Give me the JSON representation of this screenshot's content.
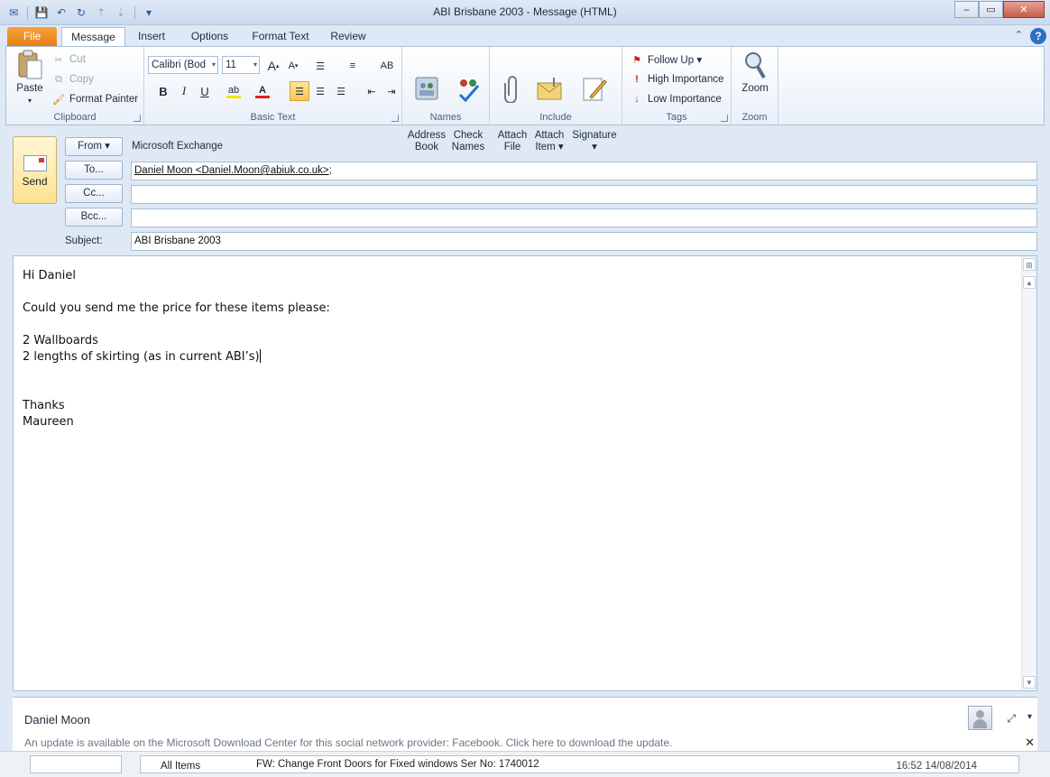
{
  "window": {
    "title": "ABI Brisbane 2003  -  Message (HTML)",
    "min_glyph": "–",
    "max_glyph": "▭",
    "close_glyph": "✕"
  },
  "qat": {
    "more_glyph": "▾"
  },
  "tabs": [
    {
      "label": "File"
    },
    {
      "label": "Message"
    },
    {
      "label": "Insert"
    },
    {
      "label": "Options"
    },
    {
      "label": "Format Text"
    },
    {
      "label": "Review"
    }
  ],
  "help_glyph": "?",
  "ribbon": {
    "clipboard": {
      "label": "Clipboard",
      "paste": "Paste",
      "cut": "Cut",
      "copy": "Copy",
      "format_painter": "Format Painter"
    },
    "basic_text": {
      "label": "Basic Text",
      "font_name": "Calibri (Bod",
      "font_size": "11",
      "grow": "A",
      "shrink": "A",
      "bold": "B",
      "italic": "I",
      "underline": "U"
    },
    "names": {
      "label": "Names",
      "address_book": "Address\nBook",
      "check_names": "Check\nNames"
    },
    "include": {
      "label": "Include",
      "attach_file": "Attach\nFile",
      "attach_item": "Attach\nItem ▾",
      "signature": "Signature\n▾"
    },
    "tags": {
      "label": "Tags",
      "follow_up": "Follow Up ▾",
      "high_importance": "High Importance",
      "low_importance": "Low Importance"
    },
    "zoom": {
      "label": "Zoom",
      "zoom": "Zoom"
    }
  },
  "header": {
    "send": "Send",
    "from_button": "From ▾",
    "from_value": "Microsoft Exchange",
    "to_button": "To...",
    "to_value": "Daniel Moon <Daniel.Moon@abiuk.co.uk>",
    "to_suffix": ";",
    "cc_button": "Cc...",
    "bcc_button": "Bcc...",
    "subject_label": "Subject:",
    "subject_value": "ABI Brisbane 2003"
  },
  "body": {
    "lines": [
      "Hi Daniel",
      "",
      "Could you send me the price for these items please:",
      "",
      "2 Wallboards",
      "2 lengths of skirting (as in current ABI’s)",
      "",
      "",
      "Thanks",
      "Maureen"
    ]
  },
  "people_pane": {
    "name": "Daniel Moon",
    "info": "An update is available on the Microsoft Download Center for this social network provider: Facebook. Click here to download the update.",
    "close_glyph": "✕",
    "expand_glyph": "⤢",
    "chevron_glyph": "▾"
  },
  "bottom": {
    "all_items": "All Items",
    "message": "FW: Change Front Doors for Fixed windows Ser No: 1740012",
    "datetime": "16:52 14/08/2014"
  },
  "colors": {
    "file_tab": "#e57b12",
    "help": "#2f6fc4",
    "send_bg": "#fde28e"
  }
}
